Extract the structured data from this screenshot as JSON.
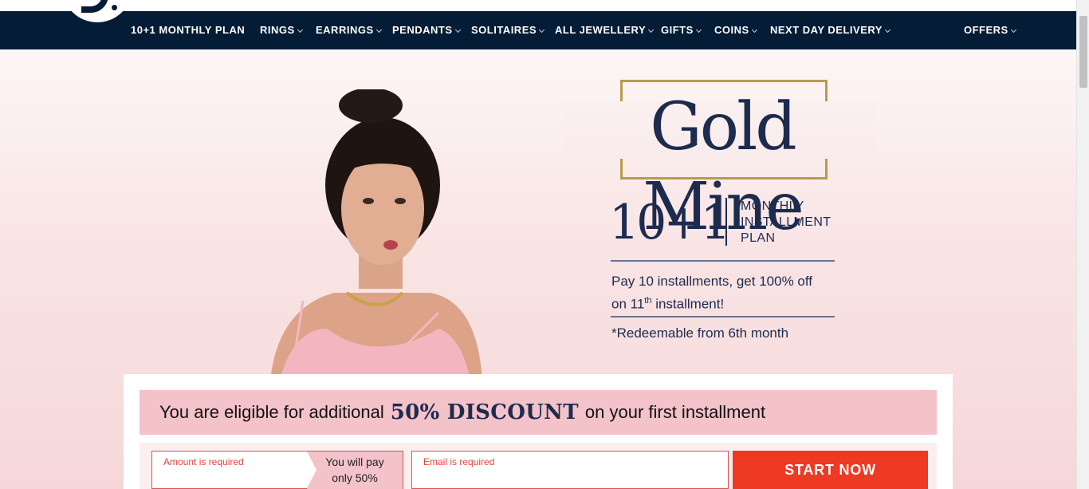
{
  "nav": {
    "items": [
      {
        "label": "10+1 MONTHLY PLAN",
        "has_chevron": false
      },
      {
        "label": "RINGS",
        "has_chevron": true
      },
      {
        "label": "EARRINGS",
        "has_chevron": true
      },
      {
        "label": "PENDANTS",
        "has_chevron": true
      },
      {
        "label": "SOLITAIRES",
        "has_chevron": true
      },
      {
        "label": "ALL JEWELLERY",
        "has_chevron": true
      },
      {
        "label": "GIFTS",
        "has_chevron": true
      },
      {
        "label": "COINS",
        "has_chevron": true
      },
      {
        "label": "NEXT DAY DELIVERY",
        "has_chevron": true
      },
      {
        "label": "OFFERS",
        "has_chevron": true
      }
    ],
    "background": "#041c36"
  },
  "hero": {
    "title": "Gold Mine",
    "plan_number": "10+1",
    "plan_lines": [
      "MONTHLY",
      "INSTALLMENT",
      "PLAN"
    ],
    "offer_pre": "Pay 10 installments, get 100% off",
    "offer_on": "on 11",
    "offer_sup": "th",
    "offer_post": " installment!",
    "redeem": "*Redeemable from 6th month"
  },
  "discount": {
    "pre": "You are eligible for additional",
    "highlight": "50% DISCOUNT",
    "post": "on your first installment"
  },
  "form": {
    "amount_error": "Amount is required",
    "pay_note_line1": "You will pay",
    "pay_note_line2": "only 50%",
    "email_error": "Email is required",
    "submit_label": "START NOW"
  },
  "colors": {
    "navy": "#1d2b4f",
    "gold": "#b89b4c",
    "pink": "#f4c2c9",
    "cta": "#ee3a23"
  }
}
